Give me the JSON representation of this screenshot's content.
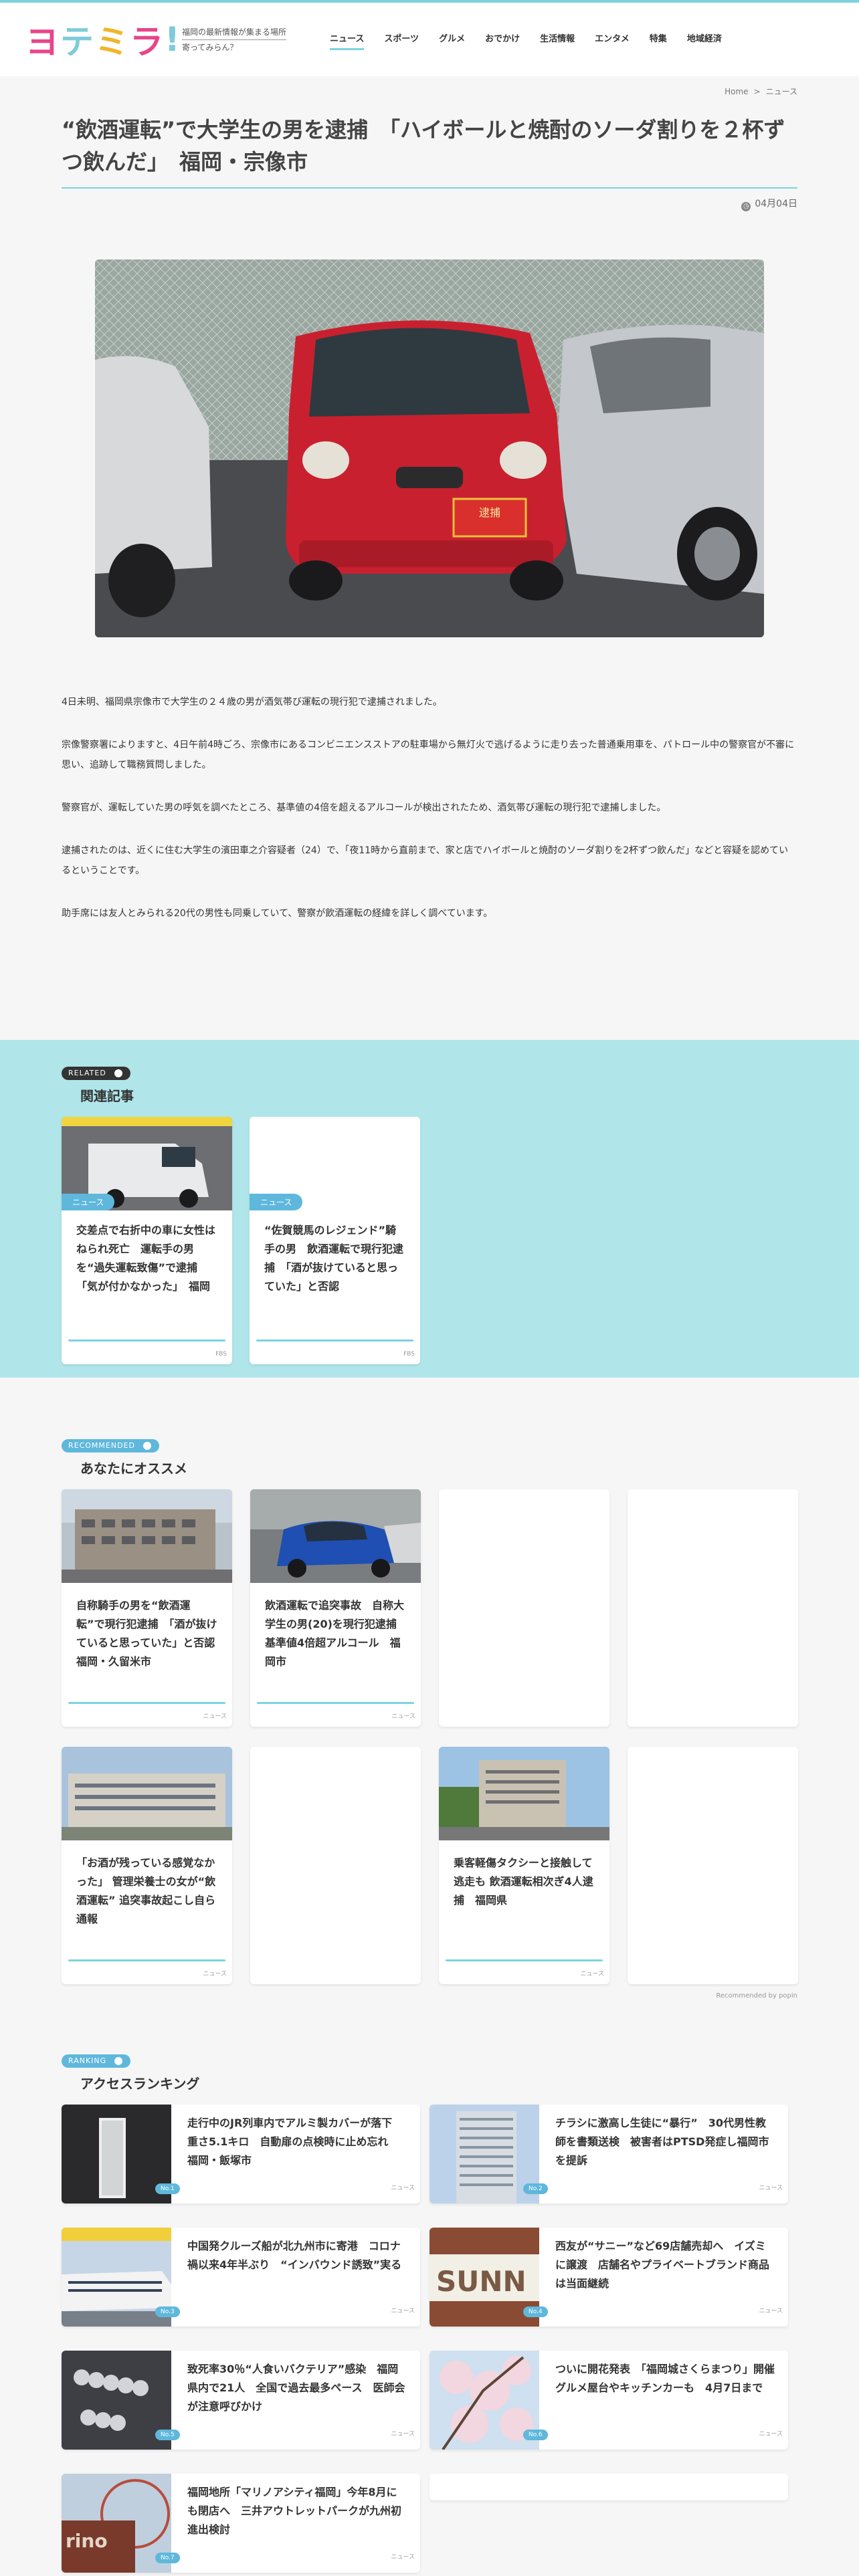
{
  "site": {
    "logo": [
      "ヨ",
      "テ",
      "ミ",
      "ラ",
      "!"
    ],
    "tagline_1": "福岡の最新情報が集まる場所",
    "tagline_2": "寄ってみらん？"
  },
  "nav": [
    "ニュース",
    "スポーツ",
    "グルメ",
    "おでかけ",
    "生活情報",
    "エンタメ",
    "特集",
    "地域経済"
  ],
  "breadcrumb": {
    "home": "Home",
    "sep": ">",
    "current": "ニュース"
  },
  "article": {
    "title": "“飲酒運転”で大学生の男を逮捕　「ハイボールと焼酎のソーダ割りを２杯ずつ飲んだ」　福岡・宗像市",
    "date": "04月04日",
    "paragraphs": [
      "4日未明、福岡県宗像市で大学生の２４歳の男が酒気帯び運転の現行犯で逮捕されました。",
      "宗像警察署によりますと、4日午前4時ごろ、宗像市にあるコンビニエンスストアの駐車場から無灯火で逃げるように走り去った普通乗用車を、パトロール中の警察官が不審に思い、追跡して職務質問しました。",
      "警察官が、運転していた男の呼気を調べたところ、基準値の4倍を超えるアルコールが検出されたため、酒気帯び運転の現行犯で逮捕しました。",
      "逮捕されたのは、近くに住む大学生の濱田車之介容疑者（24）で、「夜11時から直前まで、家と店でハイボールと焼酎のソーダ割りを2杯ずつ飲んだ」などと容疑を認めているということです。",
      "助手席には友人とみられる20代の男性も同乗していて、警察が飲酒運転の経緯を詳しく調べています。"
    ],
    "plate": "逮捕"
  },
  "related": {
    "pill": "RELATED",
    "title": "関連記事",
    "items": [
      {
        "cat": "ニュース",
        "title": "交差点で右折中の車に女性はねられ死亡　運転手の男を“過失運転致傷”で逮捕　「気が付かなかった」　福岡",
        "meta": "FBS"
      },
      {
        "cat": "ニュース",
        "title": "“佐賀競馬のレジェンド”騎手の男　飲酒運転で現行犯逮捕　「酒が抜けていると思っていた」と否認",
        "meta": "FBS"
      }
    ]
  },
  "recommend": {
    "pill": "RECOMMENDED",
    "title": "あなたにオススメ",
    "items": [
      {
        "title": "自称騎手の男を“飲酒運転”で現行犯逮捕　「酒が抜けていると思っていた」と否認　福岡・久留米市",
        "meta": "ニュース",
        "img": "building"
      },
      {
        "title": "飲酒運転で追突事故　自称大学生の男(20)を現行犯逮捕　基準値4倍超アルコール　福岡市",
        "meta": "ニュース",
        "img": "car"
      },
      {
        "title": "",
        "meta": "",
        "img": ""
      },
      {
        "title": "",
        "meta": "",
        "img": ""
      },
      {
        "title": "「お酒が残っている感覚なかった」 管理栄養士の女が“飲酒運転” 追突事故起こし自ら通報",
        "meta": "ニュース",
        "img": "police"
      },
      {
        "title": "",
        "meta": "",
        "img": ""
      },
      {
        "title": "乗客軽傷タクシーと接触して逃走も 飲酒運転相次ぎ4人逮捕　福岡県",
        "meta": "ニュース",
        "img": "station"
      },
      {
        "title": "",
        "meta": "",
        "img": ""
      }
    ],
    "popin": "Recommended by  popin"
  },
  "ranking": {
    "pill": "RANKING",
    "title": "アクセスランキング",
    "items": [
      {
        "title": "走行中のJR列車内でアルミ製カバーが落下　重さ5.1キロ　自動扉の点検時に止め忘れ　福岡・飯塚市",
        "badge": "No.1",
        "meta": "ニュース",
        "img": "dark"
      },
      {
        "title": "チラシに激高し生徒に“暴行”　30代男性教師を書類送検　被害者はPTSD発症し福岡市を提訴",
        "badge": "No.2",
        "meta": "ニュース",
        "img": "tower"
      },
      {
        "title": "中国発クルーズ船が北九州市に寄港　コロナ禍以来4年半ぶり　“インバウンド誘致”実る",
        "badge": "No.3",
        "meta": "ニュース",
        "img": "ship"
      },
      {
        "title": "西友が“サニー”など69店舗売却へ　イズミに譲渡　店舗名やプライベートブランド商品は当面継続",
        "badge": "No.4",
        "meta": "ニュース",
        "img": "sunny"
      },
      {
        "title": "致死率30％“人食いバクテリア”感染　福岡県内で21人　全国で過去最多ペース　医師会が注意呼びかけ",
        "badge": "No.5",
        "meta": "ニュース",
        "img": "bacteria"
      },
      {
        "title": "ついに開花発表　「福岡城さくらまつり」開催　グルメ屋台やキッチンカーも　4月7日まで",
        "badge": "No.6",
        "meta": "ニュース",
        "img": "sakura"
      },
      {
        "title": "福岡地所「マリノアシティ福岡」今年8月にも閉店へ　三井アウトレットパークが九州初進出検討",
        "badge": "No.7",
        "meta": "ニュース",
        "img": "wheel"
      },
      {
        "title": "",
        "badge": "",
        "meta": "",
        "img": ""
      }
    ]
  }
}
